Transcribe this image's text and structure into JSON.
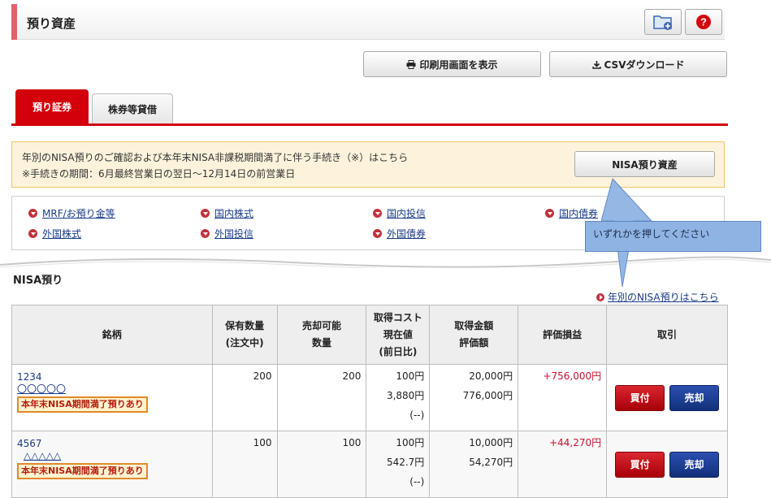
{
  "header": {
    "title": "預り資産",
    "folder_icon": "folder-add-icon",
    "help_icon": "help-icon"
  },
  "toolbar": {
    "print_label": "印刷用画面を表示",
    "csv_label": "CSVダウンロード"
  },
  "tabs": [
    {
      "label": "預り証券",
      "active": true
    },
    {
      "label": "株券等貸借",
      "active": false
    }
  ],
  "notice": {
    "line1": "年別のNISA預りのご確認および本年末NISA非課税期間満了に伴う手続き（※）はこちら",
    "line2": "※手続きの期間：6月最終営業日の翌日～12月14日の前営業日",
    "button_label": "NISA預り資産"
  },
  "links": [
    {
      "label": "MRF/お預り金等"
    },
    {
      "label": "国内株式"
    },
    {
      "label": "国内投信"
    },
    {
      "label": "国内債券"
    },
    {
      "label": "外国株式"
    },
    {
      "label": "外国投信"
    },
    {
      "label": "外国債券"
    }
  ],
  "tooltip": "いずれかを押してください",
  "section": {
    "title": "NISA預り",
    "yearly_link": "年別のNISA預りはこちら"
  },
  "table": {
    "headers": {
      "name": "銘柄",
      "qty1": "保有数量",
      "qty2": "(注文中)",
      "sellable1": "売却可能",
      "sellable2": "数量",
      "cost1": "取得コスト",
      "cost2": "現在値",
      "cost3": "(前日比)",
      "amount1": "取得金額",
      "amount2": "評価額",
      "pl": "評価損益",
      "trade": "取引"
    },
    "rows": [
      {
        "code": "1234",
        "name": "〇〇〇〇〇",
        "badge": "本年末NISA期間満了預りあり",
        "qty": "200",
        "sellable": "200",
        "cost": "100円",
        "price": "3,880円",
        "change": "(--)",
        "acq_amount": "20,000円",
        "eval_amount": "776,000円",
        "pl": "+756,000円",
        "buy_label": "買付",
        "sell_label": "売却"
      },
      {
        "code": "4567",
        "name": "△△△△△",
        "badge": "本年末NISA期間満了預りあり",
        "qty": "100",
        "sellable": "100",
        "cost": "100円",
        "price": "542.7円",
        "change": "(--)",
        "acq_amount": "10,000円",
        "eval_amount": "54,270円",
        "pl": "+44,270円",
        "buy_label": "買付",
        "sell_label": "売却"
      }
    ]
  },
  "colors": {
    "accent": "#d3000b",
    "notice_bg": "#fdf3dc",
    "tooltip_bg": "#8fb4e3",
    "link": "#1a3c8a",
    "gain": "#c8102e"
  }
}
